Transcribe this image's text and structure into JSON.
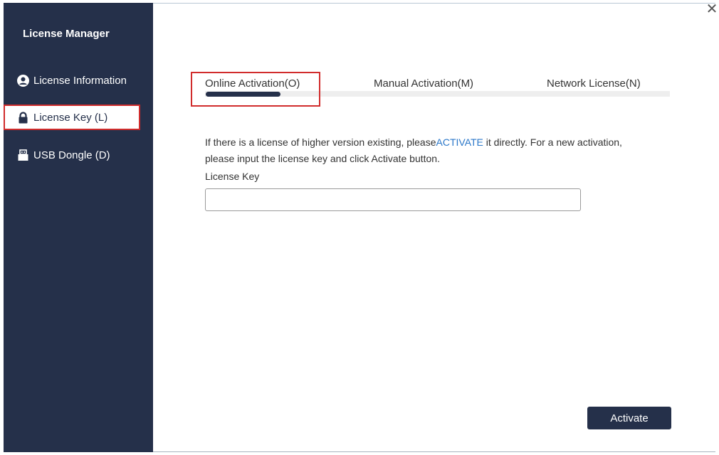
{
  "app": {
    "title": "License Manager",
    "close_glyph": "✕"
  },
  "sidebar": {
    "items": [
      {
        "label": "License Information",
        "icon": "user-circle-icon",
        "active": false
      },
      {
        "label": "License Key (L)",
        "icon": "lock-icon",
        "active": true
      },
      {
        "label": "USB Dongle (D)",
        "icon": "usb-dongle-icon",
        "active": false
      }
    ]
  },
  "tabs": [
    {
      "label": "Online Activation(O)",
      "active": true
    },
    {
      "label": "Manual Activation(M)",
      "active": false
    },
    {
      "label": "Network License(N)",
      "active": false
    }
  ],
  "online": {
    "desc_part1": "If there is a license of higher version existing, please",
    "desc_link": "ACTIVATE",
    "desc_part2": " it directly. For a new activation, please input the license key and click Activate button.",
    "key_label": "License Key",
    "key_value": "",
    "key_placeholder": "",
    "activate_label": "Activate"
  },
  "colors": {
    "sidebar_bg": "#25304a",
    "highlight": "#d12c2c",
    "link": "#2a77c9"
  }
}
